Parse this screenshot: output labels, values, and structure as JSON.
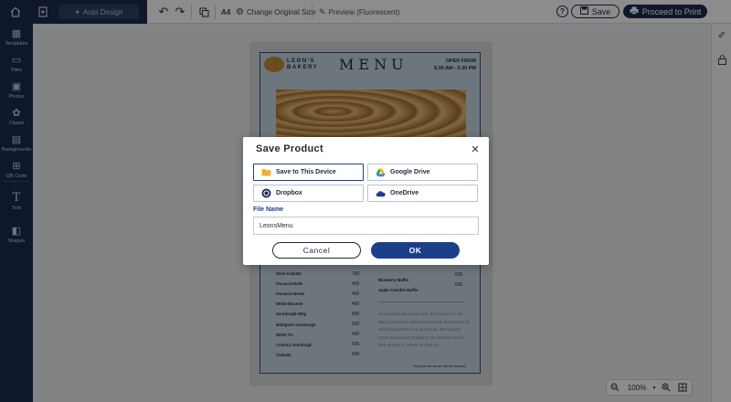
{
  "toolbar": {
    "auto_design_label": "Auto Design",
    "page_size_label": "A4",
    "change_size_label": "Change Original Size",
    "preview_label": "Preview (Fluorescent)",
    "save_label": "Save",
    "print_label": "Proceed to Print"
  },
  "sidebar": {
    "items": [
      {
        "label": "Templates",
        "icon": "templates-icon"
      },
      {
        "label": "Files",
        "icon": "folder-icon"
      },
      {
        "label": "Photos",
        "icon": "image-icon"
      },
      {
        "label": "Clipart",
        "icon": "clipart-icon"
      },
      {
        "label": "Backgrounds",
        "icon": "backgrounds-icon"
      },
      {
        "label": "QR Code",
        "icon": "qr-icon"
      },
      {
        "label": "Text",
        "icon": "text-icon"
      },
      {
        "label": "Shapes",
        "icon": "shapes-icon"
      }
    ]
  },
  "document": {
    "bakery_name_line1": "LEON'S",
    "bakery_name_line2": "BAKERY",
    "menu_title": "MENU",
    "hours_line1": "OPEN FROM",
    "hours_line2": "8.30 AM - 5.30 PM",
    "items_left": [
      {
        "name": "Olive Ciabatta",
        "price": "700"
      },
      {
        "name": "Focaccia Rolls",
        "price": "400"
      },
      {
        "name": "Focaccia Bread",
        "price": "400"
      },
      {
        "name": "White Bloomer",
        "price": "400"
      },
      {
        "name": "Sourdough 600g",
        "price": "800"
      },
      {
        "name": "Multigrain Sourdough",
        "price": "500"
      },
      {
        "name": "White Tin",
        "price": "400"
      },
      {
        "name": "Country Sourdough",
        "price": "500"
      },
      {
        "name": "Ciabatta",
        "price": "400"
      }
    ],
    "items_right": [
      {
        "name": "Blueberry Muffin",
        "price": "600"
      },
      {
        "name": "Apple Crumble Muffin",
        "price": "600"
      }
    ],
    "note": "All our products freeze well, best frozen on the day of purchase. Defrost by leaving the product at ambient and then use as normal, alternatively check the product details on the website for the best options to refresh or heat up.",
    "footnote": "* All prices are shown with tax included."
  },
  "dialog": {
    "title": "Save Product",
    "options": [
      {
        "label": "Save to This Device",
        "icon": "folder-icon"
      },
      {
        "label": "Google Drive",
        "icon": "google-drive-icon"
      },
      {
        "label": "Dropbox",
        "icon": "dropbox-icon"
      },
      {
        "label": "OneDrive",
        "icon": "onedrive-icon"
      }
    ],
    "file_name_label": "File Name",
    "file_name_value": "LeonsMenu",
    "cancel_label": "Cancel",
    "ok_label": "OK"
  },
  "zoom": {
    "value": "100%"
  },
  "colors": {
    "navy": "#1c2d4f",
    "accent": "#1c3f8a",
    "page_bg": "#c9d7e3"
  }
}
